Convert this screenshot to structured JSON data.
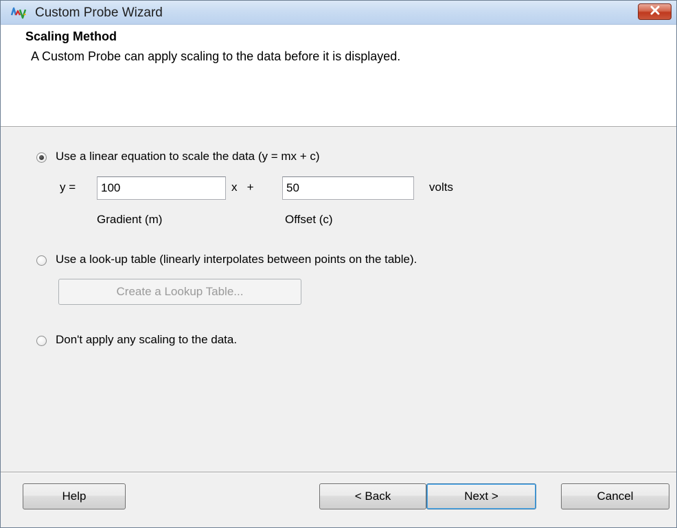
{
  "window": {
    "title": "Custom Probe Wizard",
    "close_glyph": "✕"
  },
  "header": {
    "title": "Scaling Method",
    "subtitle": "A Custom Probe can apply scaling to the data before it is displayed."
  },
  "options": {
    "linear": {
      "label": "Use a linear equation to scale the data (y = mx + c)",
      "selected": true,
      "y_prefix": "y =",
      "gradient_value": "100",
      "x_plus": "x   +",
      "offset_value": "50",
      "units": "volts",
      "gradient_caption": "Gradient (m)",
      "offset_caption": "Offset (c)"
    },
    "lookup": {
      "label": "Use a look-up table (linearly interpolates between points on the table).",
      "selected": false,
      "button_label": "Create a Lookup Table..."
    },
    "none": {
      "label": "Don't apply any scaling to the data.",
      "selected": false
    }
  },
  "footer": {
    "help_label": "Help",
    "back_label": "< Back",
    "next_label": "Next >",
    "cancel_label": "Cancel"
  },
  "colors": {
    "close_button": "#c9553a",
    "default_button_border": "#3c7fb1"
  },
  "icons": {
    "app": "probe-waveform-icon",
    "close": "close-icon"
  }
}
